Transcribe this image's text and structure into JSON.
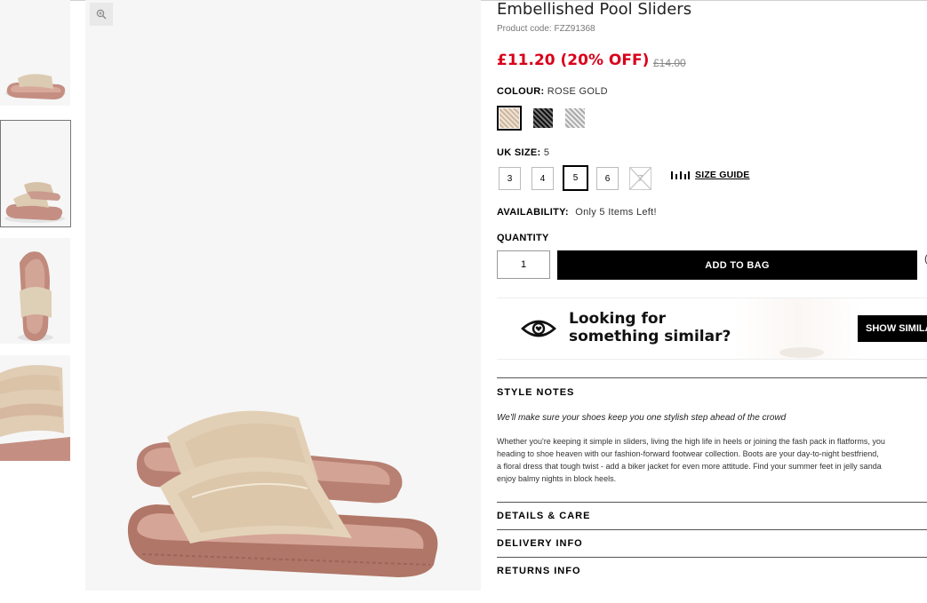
{
  "product": {
    "title": "Embellished Pool Sliders",
    "product_code": "Product code: FZZ91368",
    "price": "£11.20 (20% OFF)",
    "old_price": "£14.00"
  },
  "colour": {
    "label": "COLOUR:",
    "value": "ROSE GOLD",
    "swatches": [
      {
        "name": "rose gold",
        "color": "#d9c4b0",
        "selected": true
      },
      {
        "name": "black",
        "color": "#2a2a2a",
        "selected": false
      },
      {
        "name": "silver",
        "color": "#c8c8c8",
        "selected": false
      }
    ]
  },
  "size": {
    "label": "UK SIZE:",
    "value": "5",
    "options": [
      "3",
      "4",
      "5",
      "6",
      "7"
    ],
    "selected": "5",
    "out_of_stock": [
      "7"
    ],
    "guide_label": "SIZE GUIDE"
  },
  "availability": {
    "label": "AVAILABILITY:",
    "value": "Only 5 Items Left!"
  },
  "quantity": {
    "label": "QUANTITY",
    "value": "1"
  },
  "add_to_bag": "ADD TO BAG",
  "similar": {
    "line1": "Looking for",
    "line2": "something similar?",
    "button": "SHOW SIMILAR"
  },
  "style_notes": {
    "heading": "STYLE NOTES",
    "tagline": "We'll make sure your shoes keep you one stylish step ahead of the crowd",
    "lines": [
      "Whether you're keeping it simple in sliders, living the high life in heels or joining the fash pack in flatforms, you",
      "heading to shoe heaven with our fashion-forward footwear collection. Boots are your day-to-night bestfriend,",
      "a floral dress that tough twist - add a biker jacket for even more attitude. Find your summer feet in jelly sanda",
      "enjoy balmy nights in block heels."
    ]
  },
  "accordion": {
    "details": "DETAILS & CARE",
    "delivery": "DELIVERY INFO",
    "returns": "RETURNS INFO"
  },
  "colors": {
    "price_red": "#d9001b",
    "shoe_rose": "#c99a8d",
    "strap_gold": "#e2d2bc"
  }
}
